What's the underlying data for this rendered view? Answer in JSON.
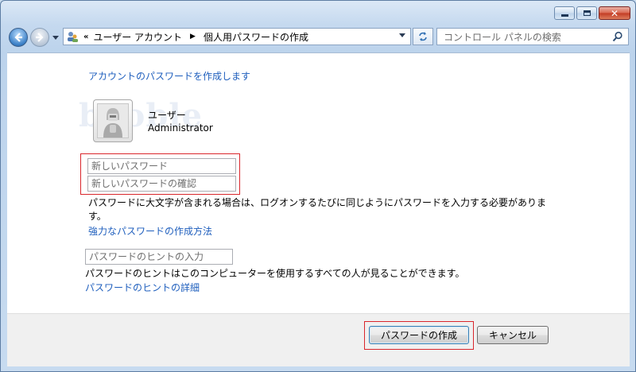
{
  "window": {
    "minimize": "minimize",
    "maximize": "maximize",
    "close": "close"
  },
  "address_bar": {
    "overflow": "«",
    "crumbs": [
      "ユーザー アカウント",
      "個人用パスワードの作成"
    ]
  },
  "search": {
    "placeholder": "コントロール パネルの検索"
  },
  "main": {
    "heading": "アカウントのパスワードを作成します",
    "watermark": "booble",
    "user": {
      "name": "ユーザー",
      "role": "Administrator"
    },
    "fields": {
      "new_password": "新しいパスワード",
      "confirm_password": "新しいパスワードの確認",
      "hint": "パスワードのヒントの入力"
    },
    "case_note": "パスワードに大文字が含まれる場合は、ログオンするたびに同じようにパスワードを入力する必要があります。",
    "strong_link": "強力なパスワードの作成方法",
    "hint_note": "パスワードのヒントはこのコンピューターを使用するすべての人が見ることができます。",
    "hint_link": "パスワードのヒントの詳細"
  },
  "footer": {
    "create_button": "パスワードの作成",
    "cancel_button": "キャンセル"
  },
  "colors": {
    "link": "#1e5ebd",
    "highlight_box": "#d9262c"
  },
  "icons": [
    "back-icon",
    "forward-icon",
    "control-panel-icon",
    "refresh-icon",
    "search-icon",
    "user-avatar-icon"
  ]
}
